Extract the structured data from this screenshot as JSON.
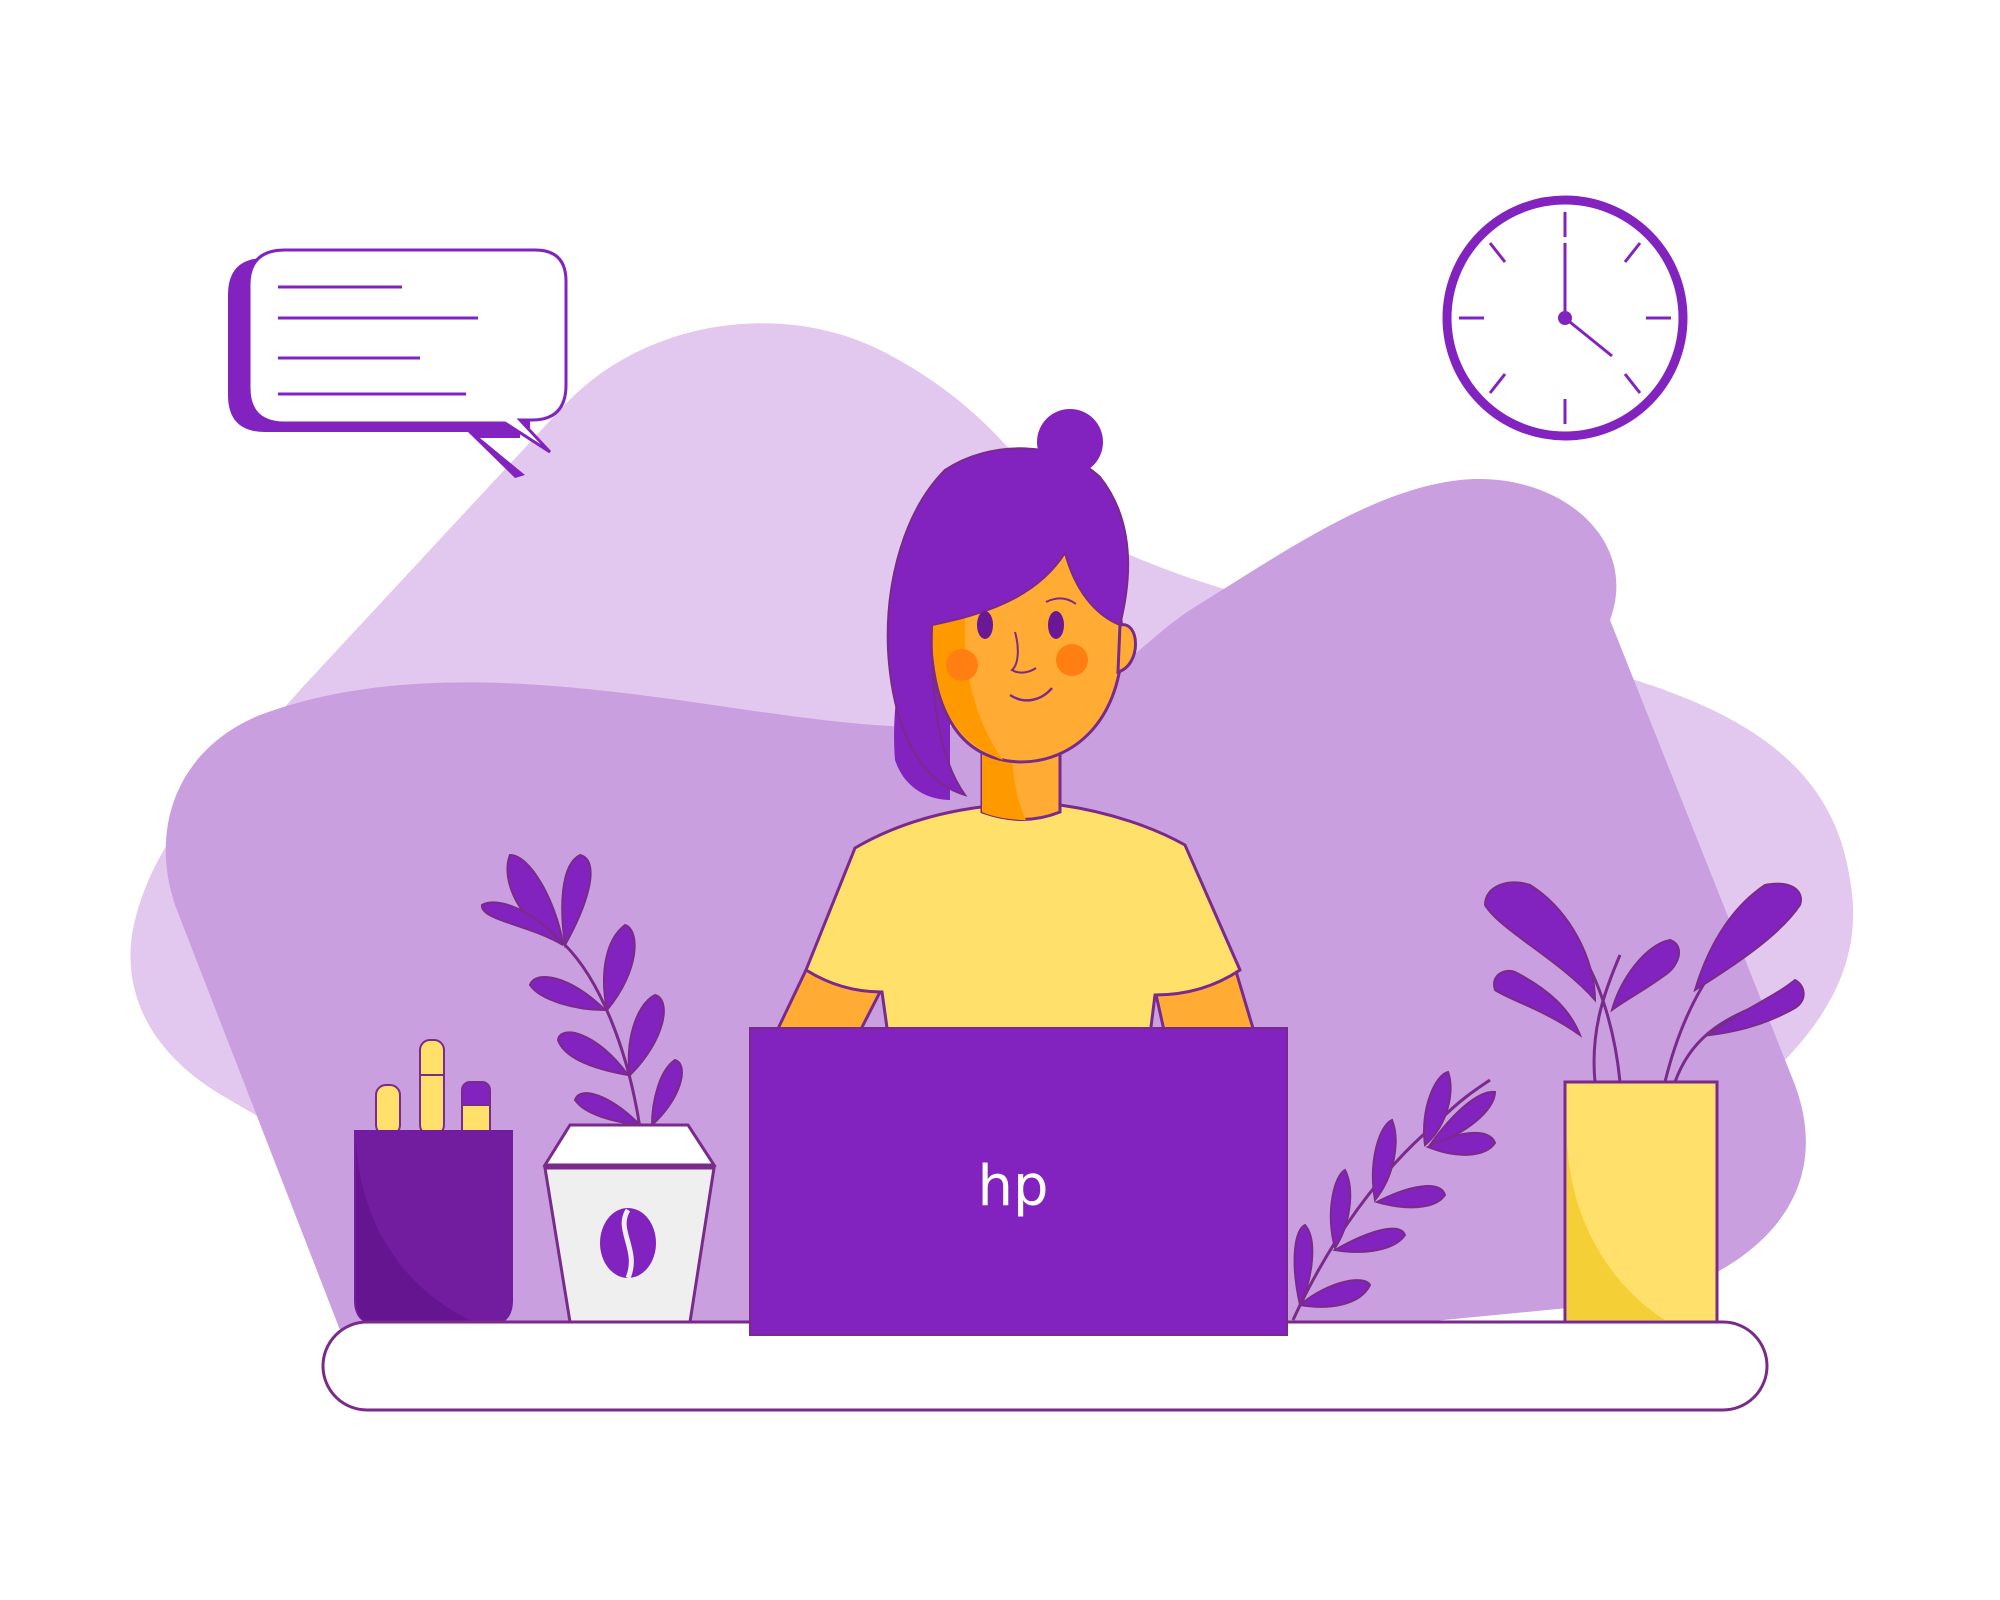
{
  "laptop": {
    "logo_text": "hp"
  },
  "colors": {
    "blob_light": "#e2c7ee",
    "blob_mid": "#c99fe0",
    "purple": "#8323bf",
    "purple_dark": "#6a1895",
    "outline": "#7a2a8a",
    "skin": "#ffab34",
    "skin_shadow": "#ff9900",
    "cheek": "#ff7f12",
    "shirt": "#ffe06a",
    "pot_yellow": "#ffe06a",
    "pot_yellow_shade": "#f4cf36",
    "cup_white": "#efefef",
    "desk": "#ffffff"
  },
  "icons": {
    "speech_bubble": "speech-bubble-icon",
    "clock": "wall-clock-icon",
    "coffee_bean": "coffee-bean-icon"
  }
}
